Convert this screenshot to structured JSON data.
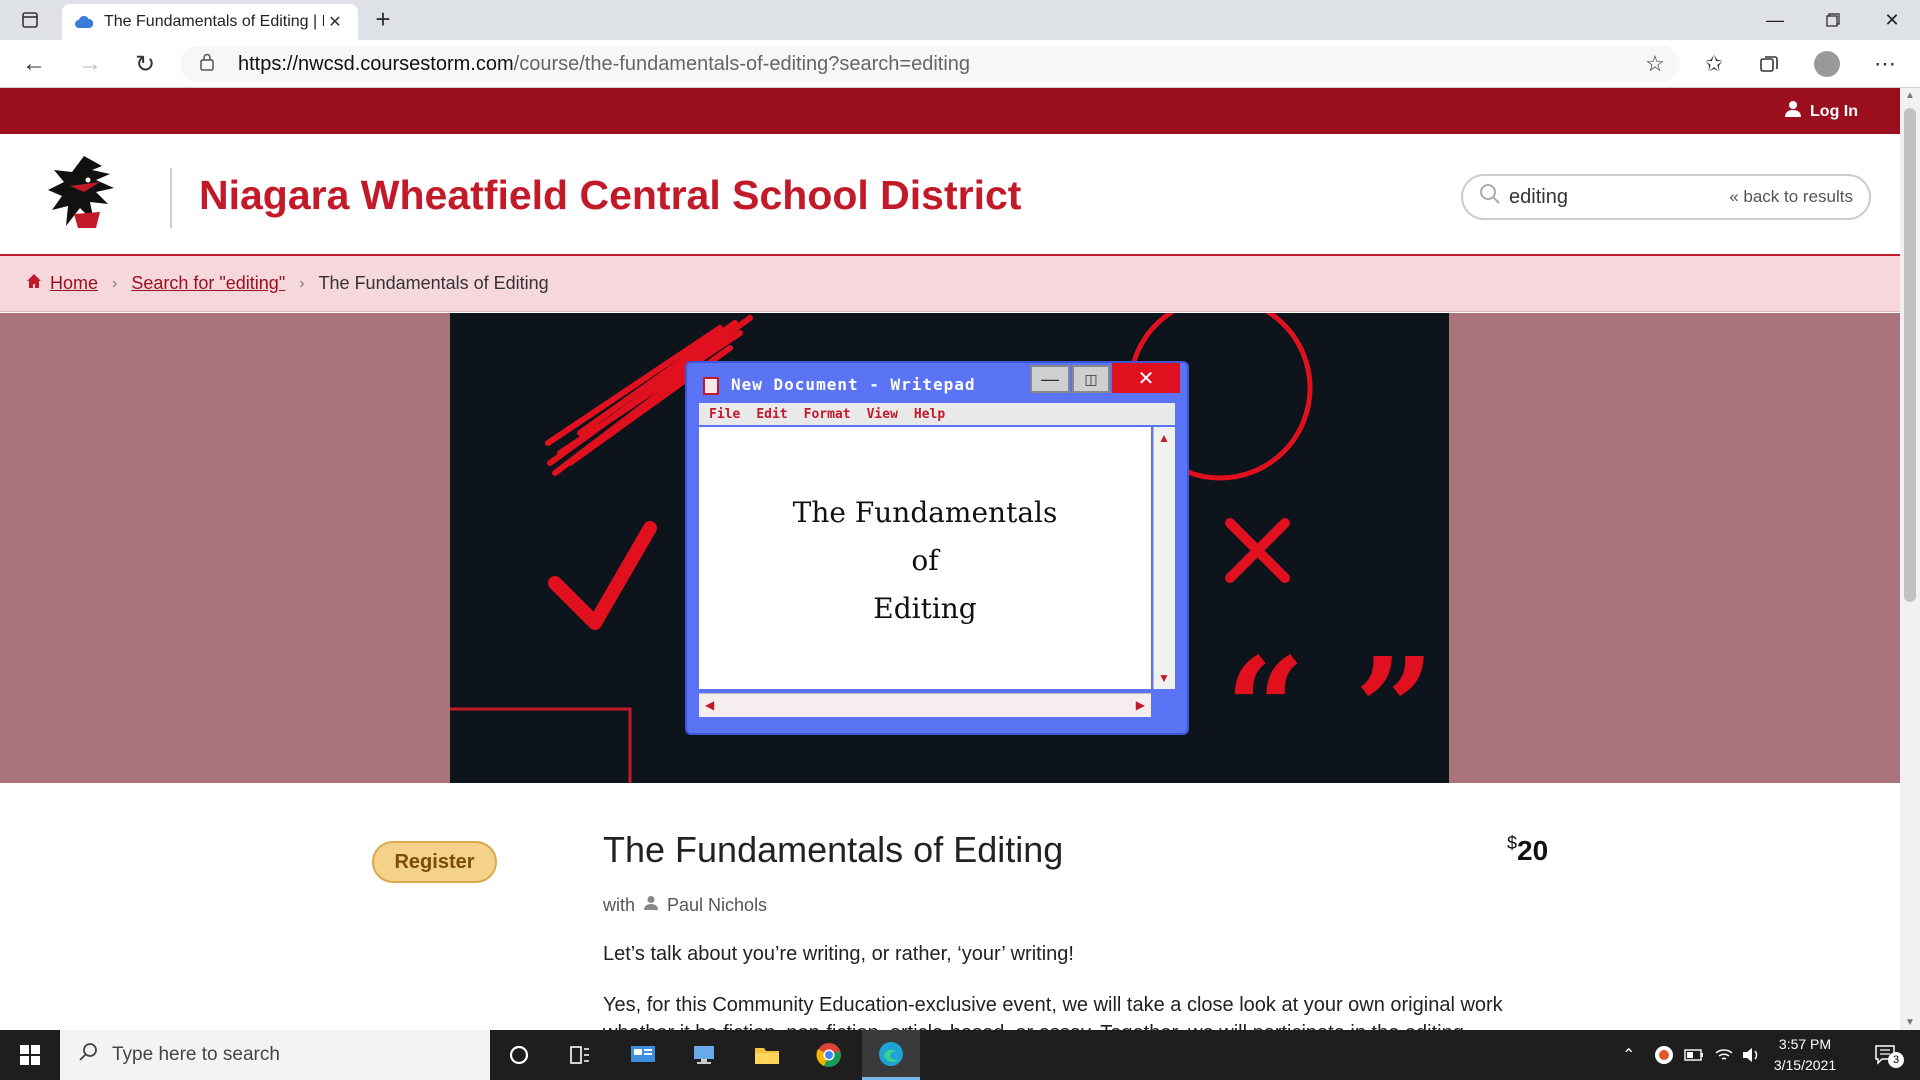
{
  "browser": {
    "tab_title": "The Fundamentals of Editing | Ni",
    "url_host": "https://nwcsd.coursestorm.com",
    "url_path": "/course/the-fundamentals-of-editing?search=editing"
  },
  "site": {
    "login_label": "Log In",
    "title": "Niagara Wheatfield Central School District",
    "search_value": "editing",
    "back_label": "« back to results"
  },
  "breadcrumbs": {
    "home": "Home",
    "search": "Search for \"editing\"",
    "current": "The Fundamentals of Editing"
  },
  "hero": {
    "window_title": "New Document - Writepad",
    "menu": [
      "File",
      "Edit",
      "Format",
      "View",
      "Help"
    ],
    "doc_line1": "The Fundamentals",
    "doc_line2": "of",
    "doc_line3": "Editing"
  },
  "course": {
    "register_label": "Register",
    "title": "The Fundamentals of Editing",
    "price_symbol": "$",
    "price": "20",
    "with_label": "with",
    "instructor": "Paul Nichols",
    "para1": "Let’s talk about you’re writing, or rather, ‘your’ writing!",
    "para2": "Yes, for this Community Education-exclusive event, we will take a close look at your own original work whether it be fiction, non-fiction, article-based, or essay. Together, we will participate in the editing process."
  },
  "taskbar": {
    "search_placeholder": "Type here to search",
    "time": "3:57 PM",
    "date": "3/15/2021",
    "notif_count": "3"
  },
  "colors": {
    "brand_red": "#9a0e1e",
    "title_red": "#c31a2a",
    "crumb_bg": "#f6d7dc",
    "hero_bg": "#a8737b",
    "register_bg": "#f5d28a"
  }
}
